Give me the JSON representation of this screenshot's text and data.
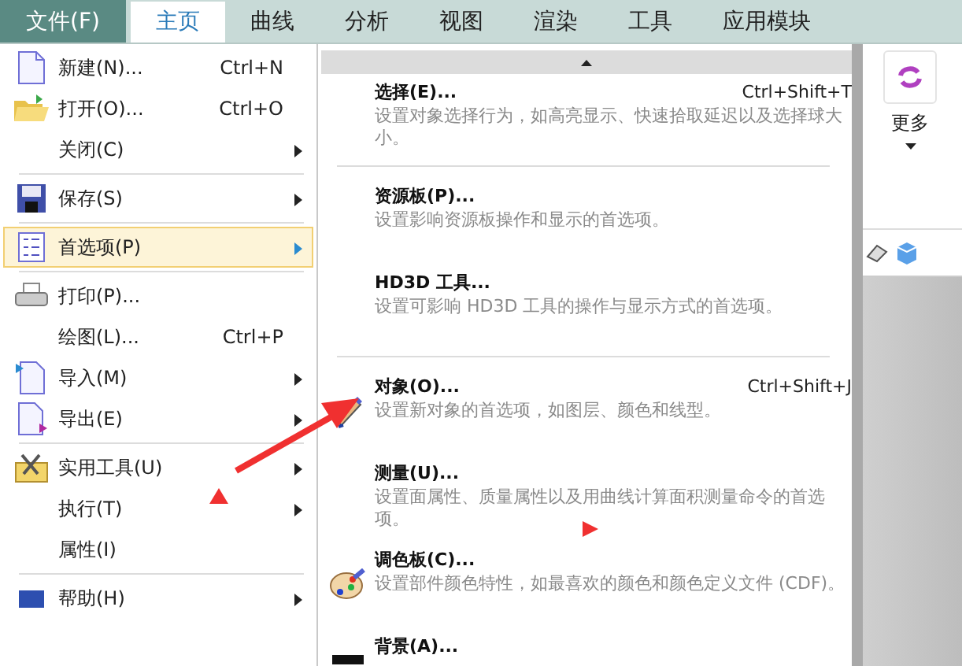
{
  "menubar": {
    "file_tab": "文件(F)",
    "tabs": [
      {
        "label": "主页",
        "selected": true
      },
      {
        "label": "曲线",
        "selected": false
      },
      {
        "label": "分析",
        "selected": false
      },
      {
        "label": "视图",
        "selected": false
      },
      {
        "label": "渲染",
        "selected": false
      },
      {
        "label": "工具",
        "selected": false
      },
      {
        "label": "应用模块",
        "selected": false
      }
    ]
  },
  "file_menu": {
    "groups": [
      [
        {
          "label": "新建(N)...",
          "shortcut": "Ctrl+N",
          "submenu": false,
          "selected": false
        },
        {
          "label": "打开(O)...",
          "shortcut": "Ctrl+O",
          "submenu": false,
          "selected": false
        },
        {
          "label": "关闭(C)",
          "submenu": true,
          "selected": false
        }
      ],
      [
        {
          "label": "保存(S)",
          "submenu": true,
          "selected": false
        }
      ],
      [
        {
          "label": "首选项(P)",
          "submenu": true,
          "selected": true
        }
      ],
      [
        {
          "label": "打印(P)...",
          "submenu": false,
          "selected": false
        },
        {
          "label": "绘图(L)...",
          "shortcut": "Ctrl+P",
          "submenu": false,
          "selected": false
        },
        {
          "label": "导入(M)",
          "submenu": true,
          "selected": false
        },
        {
          "label": "导出(E)",
          "submenu": true,
          "selected": false
        }
      ],
      [
        {
          "label": "实用工具(U)",
          "submenu": true,
          "selected": false
        },
        {
          "label": "执行(T)",
          "submenu": true,
          "selected": false
        },
        {
          "label": "属性(I)",
          "submenu": false,
          "selected": false
        }
      ],
      [
        {
          "label": "帮助(H)",
          "submenu": true,
          "selected": false
        }
      ]
    ]
  },
  "preferences_submenu": {
    "groups": [
      [
        {
          "title": "选择(E)...",
          "shortcut": "Ctrl+Shift+T",
          "description": "设置对象选择行为，如高亮显示、快速拾取延迟以及选择球大小。"
        }
      ],
      [
        {
          "title": "资源板(P)...",
          "description": "设置影响资源板操作和显示的首选项。"
        },
        {
          "title": "HD3D 工具...",
          "description": "设置可影响 HD3D 工具的操作与显示方式的首选项。"
        }
      ],
      [
        {
          "title": "对象(O)...",
          "shortcut": "Ctrl+Shift+J",
          "description": "设置新对象的首选项，如图层、颜色和线型。"
        },
        {
          "title": "测量(U)...",
          "description": "设置面属性、质量属性以及用曲线计算面积测量命令的首选项。"
        },
        {
          "title": "调色板(C)...",
          "description": "设置部件颜色特性，如最喜欢的颜色和颜色定义文件 (CDF)。"
        },
        {
          "title": "背景(A)..."
        }
      ]
    ]
  },
  "ribbon": {
    "more_label": "更多"
  }
}
